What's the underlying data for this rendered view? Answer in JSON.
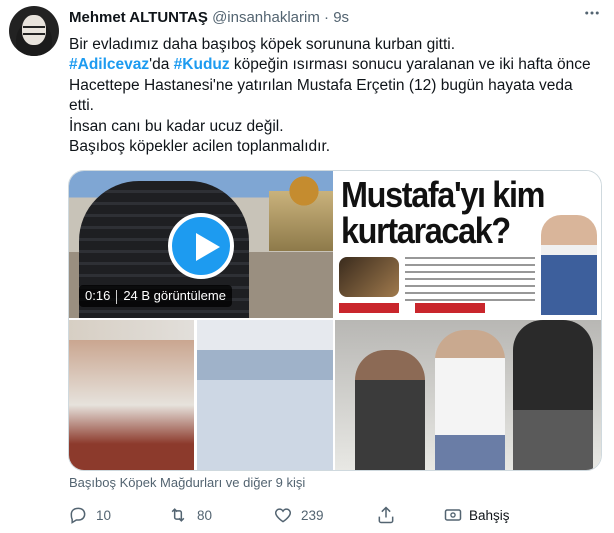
{
  "tweet": {
    "author_name": "Mehmet ALTUNTAŞ",
    "handle": "@insanhaklarim",
    "separator": "·",
    "time": "9s",
    "text": {
      "line1": "Bir evladımız daha başıboş köpek sorununa kurban gitti.",
      "hashtag1": "#Adilcevaz",
      "part2": "'da ",
      "hashtag2": "#Kuduz",
      "part3": " köpeğin ısırması sonucu yaralanan ve iki hafta önce Hacettepe Hastanesi'ne yatırılan Mustafa Erçetin (12) bugün hayata veda etti.",
      "line3": "İnsan canı bu kadar ucuz değil.",
      "line4": "Başıboş köpekler acilen toplanmalıdır."
    },
    "media": {
      "video_duration": "0:16",
      "video_views": "24 B görüntüleme",
      "headline": "Mustafa'yı kim kurtaracak?"
    },
    "tagged": "Başıboş Köpek Mağdurları ve diğer 9 kişi",
    "actions": {
      "replies": "10",
      "retweets": "80",
      "likes": "239",
      "tip_label": "Bahşiş"
    }
  }
}
